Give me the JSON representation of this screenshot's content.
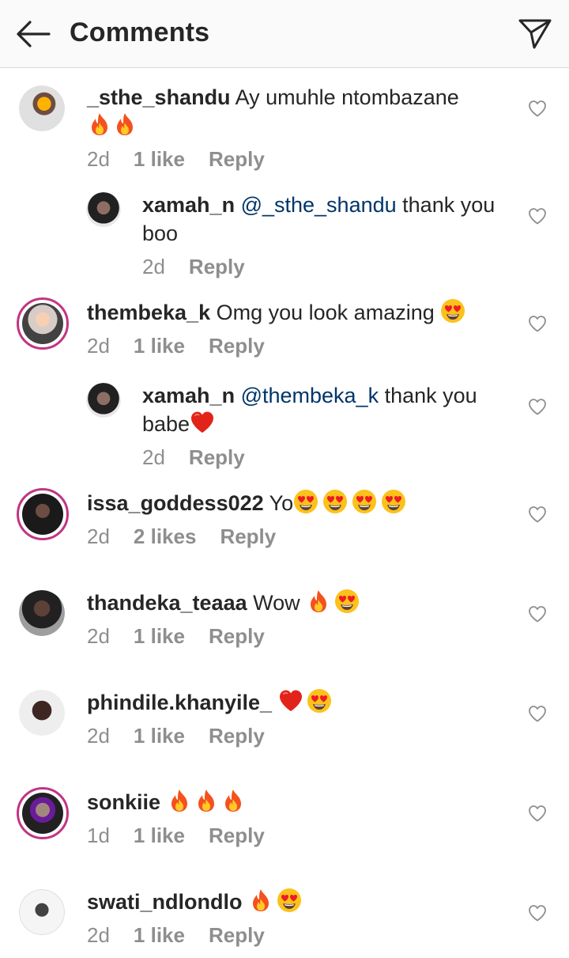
{
  "header": {
    "title": "Comments",
    "back_icon": "arrow-left-icon",
    "share_icon": "paper-plane-icon"
  },
  "colors": {
    "mention": "#003569",
    "meta": "#8e8e8e",
    "story_ring": "#c13584"
  },
  "comments": [
    {
      "username": "_sthe_shandu",
      "text": "Ay umuhle ntombazane",
      "emojis": [
        "fire",
        "fire"
      ],
      "time": "2d",
      "likes": "1 like",
      "reply": "Reply"
    },
    {
      "username": "xamah_n",
      "mention": "@_sthe_shandu",
      "text": "thank you",
      "text2": "boo",
      "time": "2d",
      "reply": "Reply"
    },
    {
      "username": "thembeka_k",
      "text": "Omg you look amazing",
      "emojis": [
        "heart-eyes"
      ],
      "time": "2d",
      "likes": "1 like",
      "reply": "Reply"
    },
    {
      "username": "xamah_n",
      "mention": "@thembeka_k",
      "text": "thank you",
      "text2": "babe",
      "emojis": [
        "red-heart"
      ],
      "time": "2d",
      "reply": "Reply"
    },
    {
      "username": "issa_goddess022",
      "text": "Yo",
      "emojis": [
        "heart-eyes",
        "heart-eyes",
        "heart-eyes",
        "heart-eyes"
      ],
      "time": "2d",
      "likes": "2 likes",
      "reply": "Reply"
    },
    {
      "username": "thandeka_teaaa",
      "text": "Wow",
      "emojis": [
        "fire",
        "heart-eyes"
      ],
      "time": "2d",
      "likes": "1 like",
      "reply": "Reply"
    },
    {
      "username": "phindile.khanyile_",
      "text": "",
      "emojis": [
        "red-heart",
        "heart-eyes"
      ],
      "time": "2d",
      "likes": "1 like",
      "reply": "Reply"
    },
    {
      "username": "sonkiie",
      "text": "",
      "emojis": [
        "fire",
        "fire",
        "fire"
      ],
      "time": "1d",
      "likes": "1 like",
      "reply": "Reply"
    },
    {
      "username": "swati_ndlondlo",
      "text": "",
      "emojis": [
        "fire",
        "heart-eyes"
      ],
      "time": "2d",
      "likes": "1 like",
      "reply": "Reply"
    }
  ]
}
